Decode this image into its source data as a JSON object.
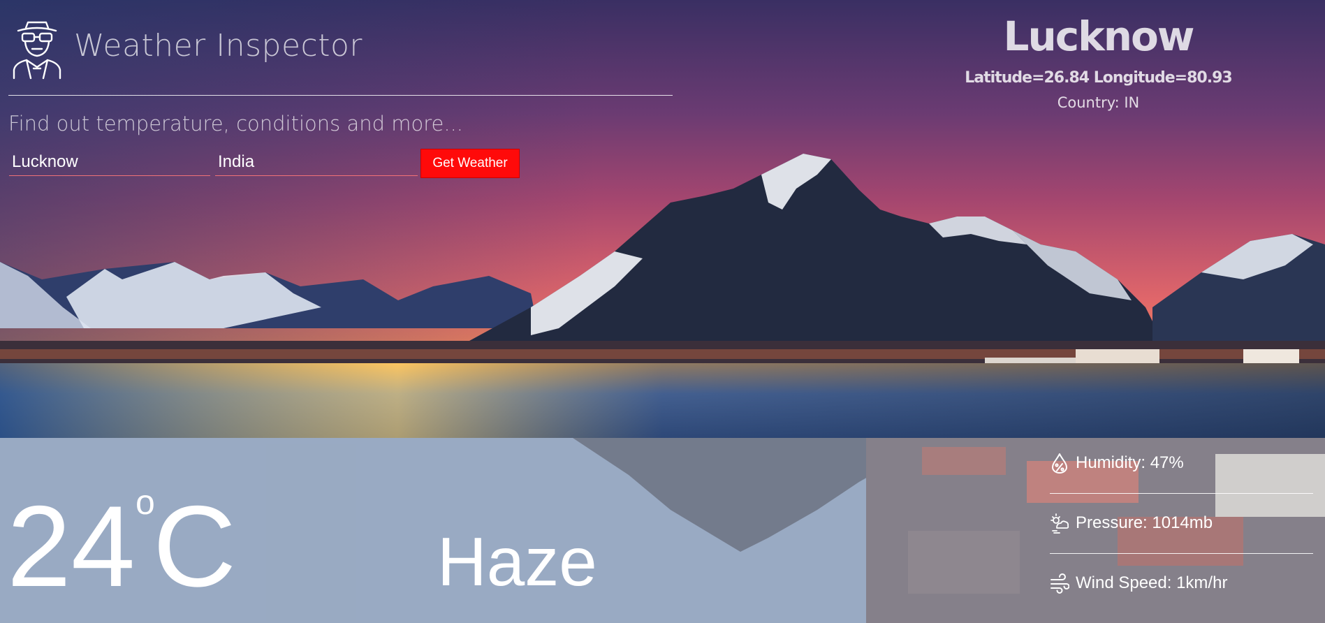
{
  "app": {
    "title": "Weather Inspector",
    "tagline": "Find out temperature, conditions and more..."
  },
  "search": {
    "city_value": "Lucknow",
    "country_value": "India",
    "button_label": "Get Weather"
  },
  "location": {
    "name": "Lucknow",
    "coordinates": "Latitude=26.84 Longitude=80.93",
    "country": "Country: IN"
  },
  "weather": {
    "temperature": "24",
    "degree_symbol": "o",
    "unit": "C",
    "condition": "Haze",
    "humidity": "Humidity: 47%",
    "pressure": "Pressure: 1014mb",
    "wind_speed": "Wind Speed: 1km/hr"
  },
  "icons": {
    "logo": "detective-icon",
    "humidity": "humidity-drop-icon",
    "pressure": "cloud-sun-icon",
    "wind": "wind-icon"
  },
  "colors": {
    "button": "#ff0a0a",
    "text": "#ffffff"
  }
}
